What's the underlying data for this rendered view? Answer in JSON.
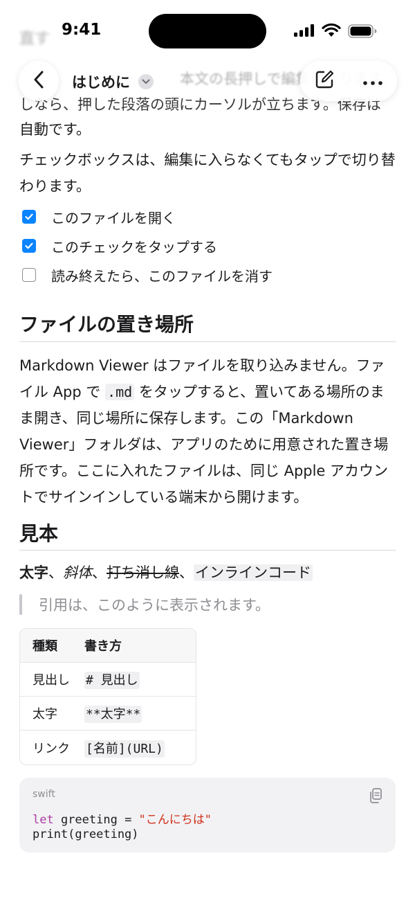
{
  "status_bar": {
    "time": "9:41"
  },
  "nav": {
    "title": "はじめに"
  },
  "doc": {
    "faded_title": "直す",
    "faded_line_1": "本文の長押しで編集に入ります。",
    "line_2": "しなら、押した段落の頭にカーソルが立ちます。保存は",
    "line_3": "自動です。",
    "checkbox_intro": "チェックボックスは、編集に入らなくてもタップで切り替わります。",
    "checklist": [
      {
        "label": "このファイルを開く",
        "checked": true
      },
      {
        "label": "このチェックをタップする",
        "checked": true
      },
      {
        "label": "読み終えたら、このファイルを消す",
        "checked": false
      }
    ],
    "section1_heading": "ファイルの置き場所",
    "section1_p_a": "Markdown Viewer はファイルを取り込みません。ファイル App で ",
    "section1_p_code": ".md",
    "section1_p_b": " をタップすると、置いてある場所のまま開き、同じ場所に保存します。この「Markdown Viewer」フォルダは、アプリのために用意された置き場所です。ここに入れたファイルは、同じ Apple アカウントでサインインしている端末から開けます。",
    "section2_heading": "見本",
    "sample_bold": "太字",
    "sample_sep1": "、",
    "sample_italic": "斜体",
    "sample_sep2": "、",
    "sample_strike": "打ち消し線",
    "sample_sep3": "、",
    "sample_code": "インラインコード",
    "quote": "引用は、このように表示されます。",
    "table": {
      "headers": [
        "種類",
        "書き方"
      ],
      "rows": [
        [
          "見出し",
          "# 見出し"
        ],
        [
          "太字",
          "**太字**"
        ],
        [
          "リンク",
          "[名前](URL)"
        ]
      ]
    },
    "code": {
      "language": "swift",
      "l1_kw": "let",
      "l1_mid": " greeting = ",
      "l1_str": "\"こんにちは\"",
      "l2": "print(greeting)"
    }
  },
  "icons": {
    "back": "chevron-left-icon",
    "title_menu": "chevron-down-icon",
    "edit": "compose-icon",
    "more": "ellipsis-icon",
    "copy": "copy-icon"
  },
  "colors": {
    "accent": "#0a84ff",
    "keyword": "#ad3da4",
    "string": "#d12f1b"
  }
}
